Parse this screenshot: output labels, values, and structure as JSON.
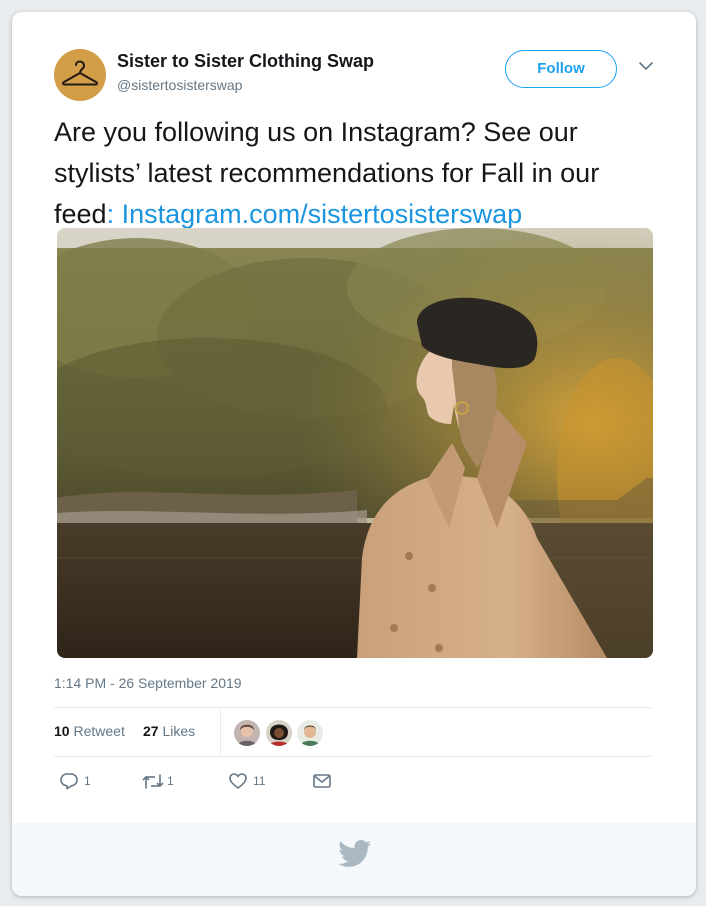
{
  "account": {
    "name": "Sister to Sister Clothing Swap",
    "handle": "@sistertosisterswap",
    "avatar_icon": "clothes-hanger-icon",
    "avatar_color": "#d49e48"
  },
  "follow_button": {
    "label": "Follow"
  },
  "tweet": {
    "text_main": "Are you following us on Instagram? See our stylists’ latest recommendations for Fall in our feed",
    "text_colon": ": ",
    "link": "Instagram.com/sistertosisterswap",
    "link_color": "#1b95e0"
  },
  "timestamp": "1:14 PM - 26 September 2019",
  "stats": {
    "retweets_count": "10",
    "retweets_label": "Retweet",
    "likes_count": "27",
    "likes_label": "Likes"
  },
  "actions": {
    "reply_count": "1",
    "retweet_count": "1",
    "like_count": "11"
  },
  "icons": [
    "chevron-down-icon",
    "reply-icon",
    "retweet-icon",
    "heart-icon",
    "direct-message-icon",
    "twitter-bird-icon"
  ]
}
